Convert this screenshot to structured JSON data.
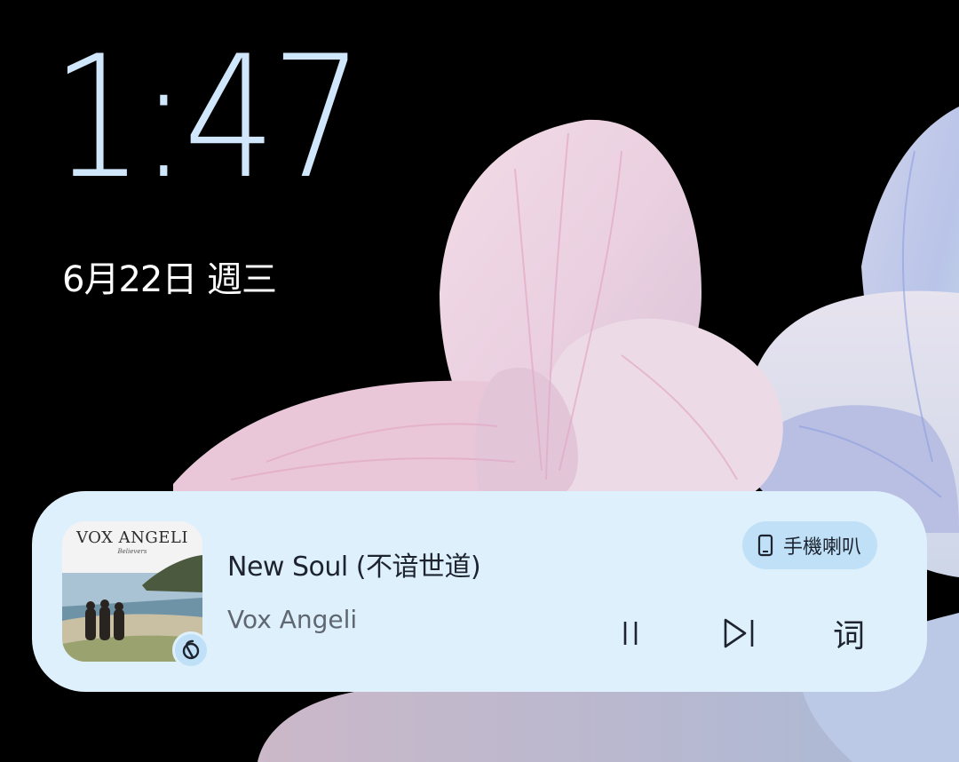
{
  "lockscreen": {
    "time": "1:47",
    "date": "6月22日 週三"
  },
  "media": {
    "album_art_title": "VOX ANGELI",
    "album_art_subtitle": "Believers",
    "song_title": "New Soul (不谙世道)",
    "artist": "Vox Angeli",
    "output_device": "手機喇叭",
    "lyrics_label": "词",
    "app_icon": "netease-music-icon",
    "controls": [
      "pause-icon",
      "skip-next-icon"
    ],
    "colors": {
      "card_background": "#dff0fd",
      "chip_background": "#bfe0f6",
      "clock": "#cfe6fb"
    }
  }
}
